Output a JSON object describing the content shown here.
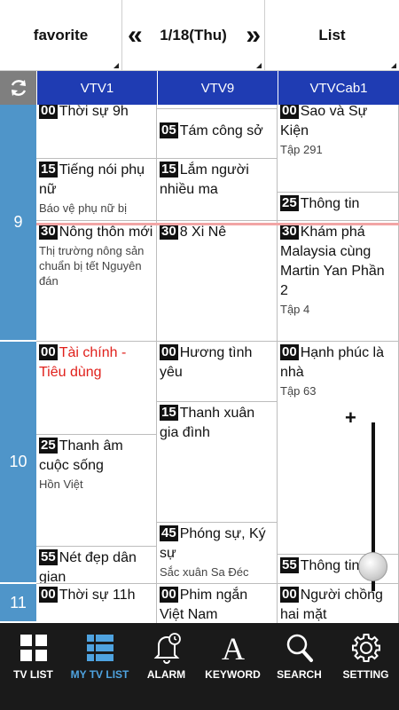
{
  "topbar": {
    "favorite": "favorite",
    "prev": "«",
    "date": "1/18(Thu)",
    "next": "»",
    "list": "List"
  },
  "channels": [
    "VTV1",
    "VTV9",
    "VTVCab1"
  ],
  "hours": [
    "9",
    "10",
    "11"
  ],
  "programs": {
    "vtv1": [
      {
        "min": "00",
        "title": "Thời sự 9h",
        "sub": ""
      },
      {
        "min": "15",
        "title": "Tiếng nói phụ nữ",
        "sub": "Báo vệ phụ nữ bị"
      },
      {
        "min": "30",
        "title": "Nông thôn mới",
        "sub": "Thị trường nông sản chuẩn bị tết Nguyên đán"
      },
      {
        "min": "00",
        "title": "Tài chính - Tiêu dùng",
        "sub": ""
      },
      {
        "min": "25",
        "title": "Thanh âm cuộc sống",
        "sub": "Hồn Việt"
      },
      {
        "min": "55",
        "title": "Nét đẹp dân gian",
        "sub": ""
      },
      {
        "min": "00",
        "title": "Thời sự 11h",
        "sub": ""
      }
    ],
    "vtv9": [
      {
        "min": "05",
        "title": "Tám công sở",
        "sub": ""
      },
      {
        "min": "15",
        "title": "Lắm người nhiều ma",
        "sub": ""
      },
      {
        "min": "30",
        "title": "8 Xi Nê",
        "sub": ""
      },
      {
        "min": "00",
        "title": "Hương tình yêu",
        "sub": ""
      },
      {
        "min": "15",
        "title": "Thanh xuân gia đình",
        "sub": ""
      },
      {
        "min": "45",
        "title": "Phóng sự, Ký sự",
        "sub": "Sắc xuân Sa Đéc"
      },
      {
        "min": "00",
        "title": "Phim ngắn Việt Nam",
        "sub": ""
      }
    ],
    "vtvcab1": [
      {
        "min": "00",
        "title": "Sao và Sự Kiện",
        "sub": "Tập 291"
      },
      {
        "min": "25",
        "title": "Thông tin",
        "sub": ""
      },
      {
        "min": "30",
        "title": "Khám phá Malaysia cùng Martin Yan Phần 2",
        "sub": "Tập 4"
      },
      {
        "min": "00",
        "title": "Hạnh phúc là nhà",
        "sub": "Tập 63"
      },
      {
        "min": "55",
        "title": "Thông tin",
        "sub": ""
      },
      {
        "min": "00",
        "title": "Người chồng hai mặt",
        "sub": ""
      }
    ]
  },
  "zoom": {
    "plus": "+"
  },
  "nav": [
    {
      "label": "TV LIST",
      "icon": "grid-icon"
    },
    {
      "label": "MY TV LIST",
      "icon": "list-icon"
    },
    {
      "label": "ALARM",
      "icon": "alarm-icon"
    },
    {
      "label": "KEYWORD",
      "icon": "keyword-icon"
    },
    {
      "label": "SEARCH",
      "icon": "search-icon"
    },
    {
      "label": "SETTING",
      "icon": "gear-icon"
    }
  ],
  "colors": {
    "channel_header": "#1f3cb3",
    "hour_column": "#4f95c9",
    "active_nav": "#4fa3e0",
    "highlight_title": "#e0201b"
  }
}
